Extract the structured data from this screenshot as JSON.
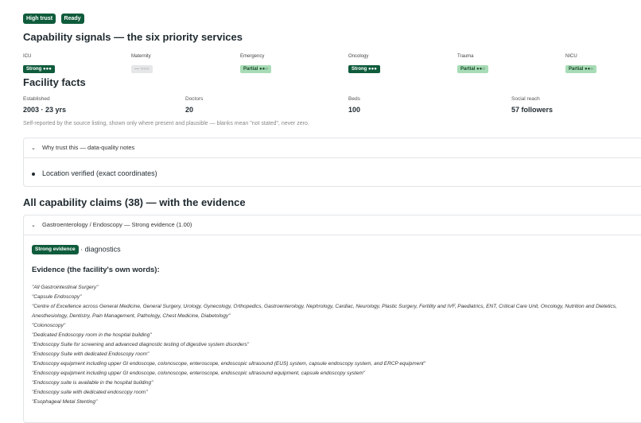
{
  "badges": [
    "High trust",
    "Ready"
  ],
  "signals": {
    "title": "Capability signals — the six priority services",
    "items": [
      {
        "label": "ICU",
        "value": "Strong ●●●",
        "level": "strong"
      },
      {
        "label": "Maternity",
        "value": "— ○○○",
        "level": "none"
      },
      {
        "label": "Emergency",
        "value": "Partial ●●○",
        "level": "partial"
      },
      {
        "label": "Oncology",
        "value": "Strong ●●●",
        "level": "strong"
      },
      {
        "label": "Trauma",
        "value": "Partial ●●○",
        "level": "partial"
      },
      {
        "label": "NICU",
        "value": "Partial ●●○",
        "level": "partial"
      }
    ]
  },
  "facts": {
    "title": "Facility facts",
    "items": [
      {
        "label": "Established",
        "value": "2003 · 23 yrs"
      },
      {
        "label": "Doctors",
        "value": "20"
      },
      {
        "label": "Beds",
        "value": "100"
      },
      {
        "label": "Social reach",
        "value": "57 followers"
      }
    ],
    "note": "Self-reported by the source listing, shown only where present and plausible — blanks mean \"not stated\", never zero."
  },
  "trust": {
    "toggle_label": "Why trust this — data-quality notes",
    "notes": [
      "Location verified (exact coordinates)"
    ]
  },
  "claims": {
    "title": "All capability claims (38) — with the evidence",
    "first": {
      "header": "Gastroenterology / Endoscopy — Strong evidence (1.00)",
      "badge": "Strong evidence",
      "category": "· diagnostics",
      "evidence_title": "Evidence (the facility's own words):",
      "quotes": [
        "\"All Gastrointestinal Surgery\"",
        "\"Capsule Endoscopy\"",
        "\"Centre of Excellence across General Medicine, General Surgery, Urology, Gynecology, Orthopedics, Gastroenterology, Nephrology, Cardiac, Neurology, Plastic Surgery, Fertility and IVF, Paediatrics, ENT, Critical Care Unit, Oncology, Nutrition and Dietetics, Anesthesiology, Dentistry, Pain Management, Pathology, Chest Medicine, Diabetology\"",
        "\"Colonoscopy\"",
        "\"Dedicated Endoscopy room in the hospital building\"",
        "\"Endoscopy Suite for screening and advanced diagnostic testing of digestive system disorders\"",
        "\"Endoscopy Suite with dedicated Endoscopy room\"",
        "\"Endoscopy equipment including upper GI endoscope, colonoscope, enteroscope, endoscopic ultrasound (EUS) system, capsule endoscopy system, and ERCP equipment\"",
        "\"Endoscopy equipment including upper GI endoscope, colonoscope, enteroscope, endoscopic ultrasound equipment, capsule endoscopy system\"",
        "\"Endoscopy suite is available in the hospital building\"",
        "\"Endoscopy suite with dedicated endoscopy room\"",
        "\"Esophageal Metal Stenting\""
      ]
    }
  }
}
